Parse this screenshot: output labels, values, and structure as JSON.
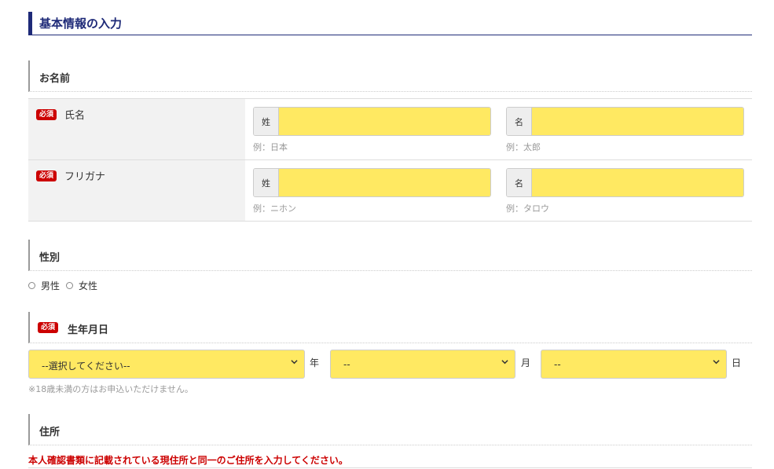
{
  "heading": "基本情報の入力",
  "sections": {
    "name": "お名前",
    "gender": "性別",
    "birthdate": "生年月日",
    "address": "住所"
  },
  "required_badge": "必須",
  "name_rows": [
    {
      "label": "氏名",
      "last": {
        "prefix": "姓",
        "value": "",
        "example": "例：日本"
      },
      "first": {
        "prefix": "名",
        "value": "",
        "example": "例：太郎"
      }
    },
    {
      "label": "フリガナ",
      "last": {
        "prefix": "姓",
        "value": "",
        "example": "例：ニホン"
      },
      "first": {
        "prefix": "名",
        "value": "",
        "example": "例：タロウ"
      }
    }
  ],
  "gender": {
    "options": [
      "男性",
      "女性"
    ],
    "selected": null
  },
  "birthdate": {
    "year": {
      "selected": "--選択してください--",
      "unit": "年"
    },
    "month": {
      "selected": "--",
      "unit": "月"
    },
    "day": {
      "selected": "--",
      "unit": "日"
    },
    "note": "※18歳未満の方はお申込いただけません。"
  },
  "address": {
    "notice": "本人確認書類に記載されている現住所と同一のご住所を入力してください。"
  },
  "colors": {
    "heading": "#1e2a78",
    "required": "#cc0000",
    "input_fill": "#ffe962",
    "label_bg": "#f2f2f2"
  }
}
